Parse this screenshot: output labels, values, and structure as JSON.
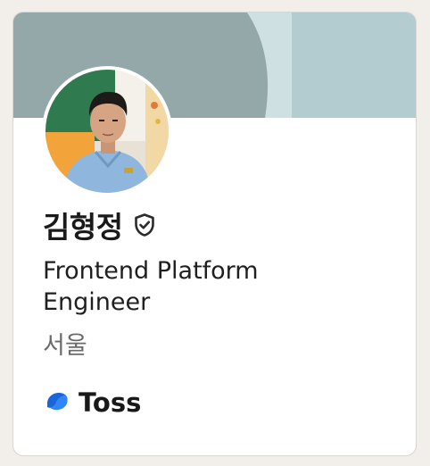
{
  "profile": {
    "name": "김형정",
    "title": "Frontend Platform Engineer",
    "location": "서울",
    "company": "Toss",
    "verified": true
  },
  "colors": {
    "banner_dark": "#94a7a9",
    "banner_light": "#cfe0e2",
    "banner_right": "#b3ccd0",
    "page_background": "#f2eee9",
    "card_background": "#ffffff",
    "toss_blue": "#1b64da"
  },
  "icons": {
    "verified": "shield-check-icon",
    "company": "toss-logo-icon"
  }
}
